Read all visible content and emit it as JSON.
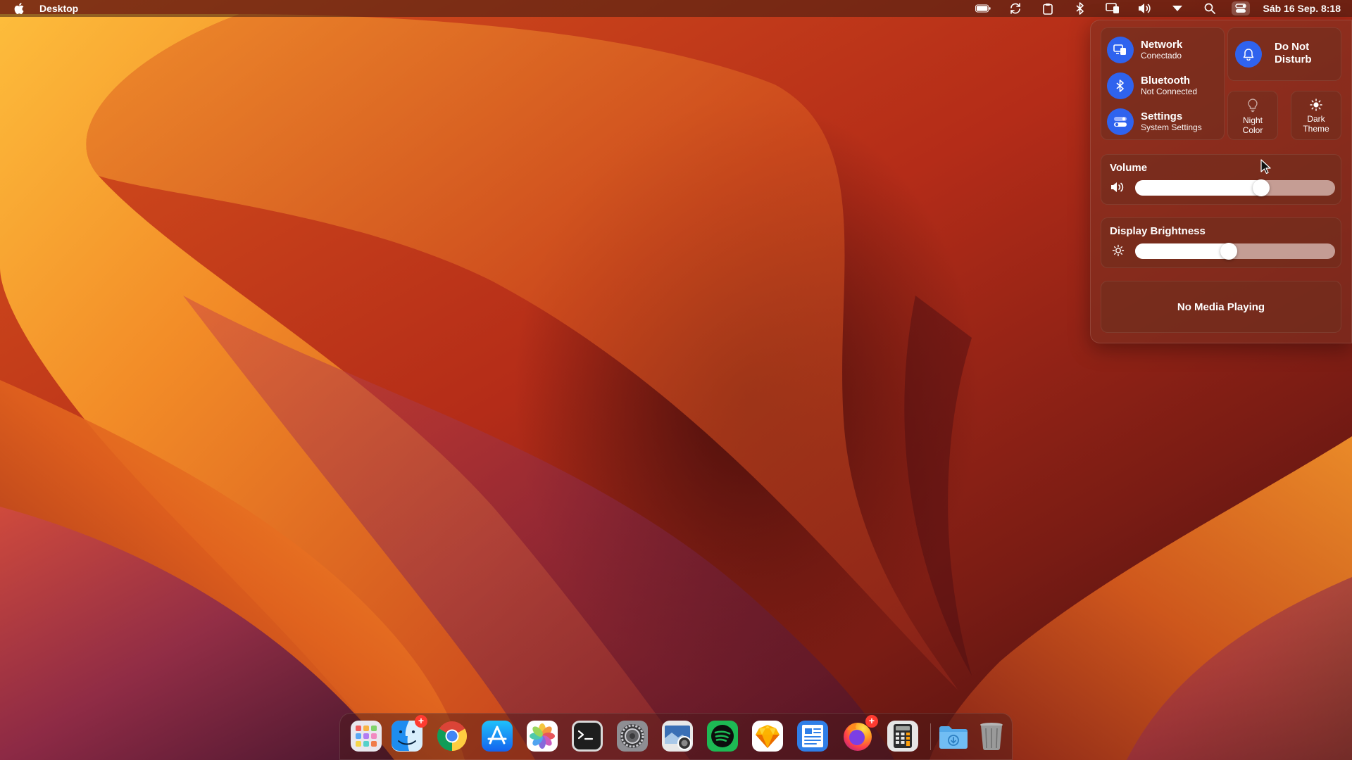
{
  "menubar": {
    "app_name": "Desktop",
    "clock": "Sáb 16 Sep. 8:18",
    "icons": [
      "apple-logo-icon",
      "battery-icon",
      "sync-icon",
      "clipboard-icon",
      "bluetooth-icon",
      "screen-mirroring-icon",
      "volume-icon",
      "wifi-icon",
      "search-icon",
      "control-center-icon"
    ]
  },
  "control_center": {
    "network": {
      "title": "Network",
      "subtitle": "Conectado"
    },
    "bluetooth": {
      "title": "Bluetooth",
      "subtitle": "Not Connected"
    },
    "settings": {
      "title": "Settings",
      "subtitle": "System Settings"
    },
    "do_not_disturb": {
      "line1": "Do Not",
      "line2": "Disturb"
    },
    "night_color": {
      "line1": "Night",
      "line2": "Color"
    },
    "dark_theme": {
      "line1": "Dark",
      "line2": "Theme"
    },
    "volume": {
      "label": "Volume",
      "level_percent": 63
    },
    "brightness": {
      "label": "Display Brightness",
      "level_percent": 47
    },
    "media": {
      "text": "No Media Playing"
    }
  },
  "dock": {
    "items": [
      {
        "name": "launchpad",
        "icon": "launchpad-icon",
        "running": false
      },
      {
        "name": "finder",
        "icon": "finder-icon",
        "running": true,
        "badge": "+"
      },
      {
        "name": "chrome",
        "icon": "chrome-icon",
        "running": false
      },
      {
        "name": "app-store",
        "icon": "app-store-icon",
        "running": false
      },
      {
        "name": "photos",
        "icon": "photos-icon",
        "running": false
      },
      {
        "name": "terminal",
        "icon": "terminal-icon",
        "running": false
      },
      {
        "name": "system-settings",
        "icon": "gear-icon",
        "running": false
      },
      {
        "name": "screenshot",
        "icon": "screenshot-icon",
        "running": false
      },
      {
        "name": "spotify",
        "icon": "spotify-icon",
        "running": false
      },
      {
        "name": "sketch",
        "icon": "sketch-icon",
        "running": false
      },
      {
        "name": "text-editor",
        "icon": "text-editor-icon",
        "running": false
      },
      {
        "name": "firefox",
        "icon": "firefox-icon",
        "running": true,
        "badge": "+"
      },
      {
        "name": "calculator",
        "icon": "calculator-icon",
        "running": false
      },
      {
        "name": "downloads",
        "icon": "downloads-folder-icon",
        "running": false
      },
      {
        "name": "trash",
        "icon": "trash-icon",
        "running": false
      }
    ]
  },
  "colors": {
    "accent": "#2f63ee",
    "badge": "#ff3b30"
  }
}
